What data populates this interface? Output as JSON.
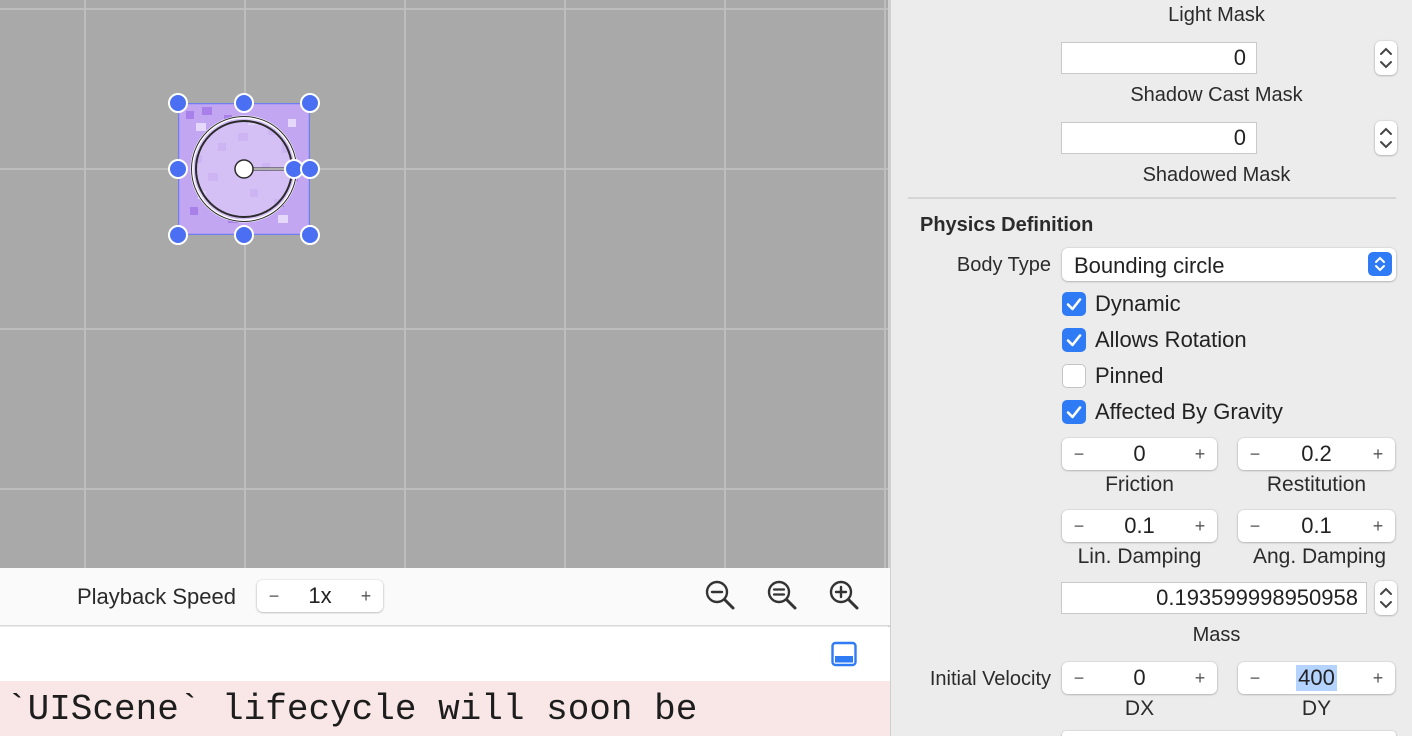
{
  "playback": {
    "label": "Playback Speed",
    "speed": "1x",
    "minus": "−",
    "plus": "+"
  },
  "zoom": {
    "icons": [
      "zoom-out-icon",
      "zoom-fit-icon",
      "zoom-in-icon"
    ]
  },
  "console": {
    "toggle_icon": "bottom-panel-icon",
    "line": "`UIScene` lifecycle will soon be"
  },
  "inspector": {
    "light_mask_label": "Light Mask",
    "light_mask_value": "0",
    "shadow_cast_mask_label": "Shadow Cast Mask",
    "shadow_cast_mask_value": "0",
    "shadowed_mask_label": "Shadowed Mask",
    "physics": {
      "title": "Physics Definition",
      "body_type_label": "Body Type",
      "body_type_value": "Bounding circle",
      "checkboxes": [
        {
          "label": "Dynamic",
          "checked": true
        },
        {
          "label": "Allows Rotation",
          "checked": true
        },
        {
          "label": "Pinned",
          "checked": false
        },
        {
          "label": "Affected By Gravity",
          "checked": true
        }
      ],
      "friction": {
        "value": "0",
        "label": "Friction"
      },
      "restitution": {
        "value": "0.2",
        "label": "Restitution"
      },
      "lin_damping": {
        "value": "0.1",
        "label": "Lin. Damping"
      },
      "ang_damping": {
        "value": "0.1",
        "label": "Ang. Damping"
      },
      "mass": {
        "value": "0.193599998950958",
        "label": "Mass"
      },
      "initial_velocity": {
        "label": "Initial Velocity",
        "dx": {
          "value": "0",
          "label": "DX"
        },
        "dy": {
          "value": "400",
          "label": "DY"
        }
      },
      "minus": "−",
      "plus": "+"
    }
  },
  "colors": {
    "accent": "#2f7bf5",
    "handle": "#4a6ff2",
    "canvas": "#a9a9a9",
    "console_bg": "#f9e6e6",
    "sprite_purple": "#b58cf0"
  }
}
